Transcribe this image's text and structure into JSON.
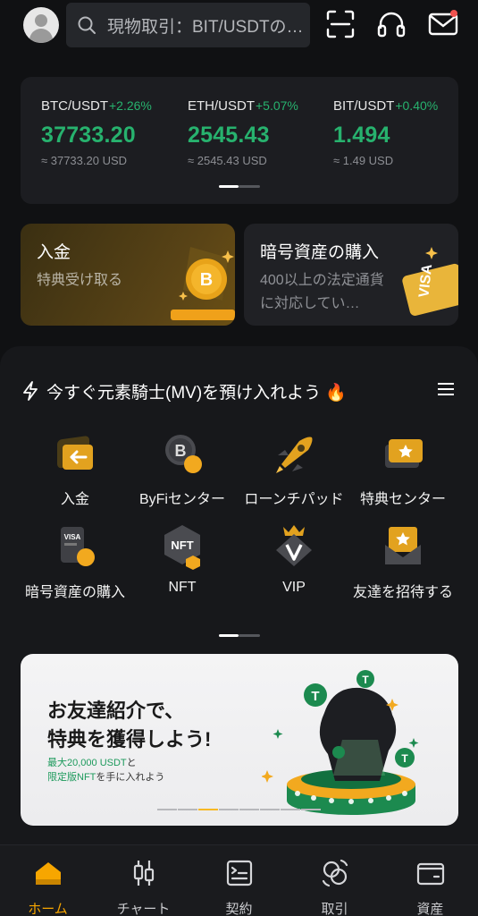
{
  "search": {
    "placeholder": "現物取引：BIT/USDTの…"
  },
  "tickers": [
    {
      "pair": "BTC/USDT",
      "change": "+2.26%",
      "price": "37733.20",
      "usd": "≈ 37733.20 USD"
    },
    {
      "pair": "ETH/USDT",
      "change": "+5.07%",
      "price": "2545.43",
      "usd": "≈ 2545.43 USD"
    },
    {
      "pair": "BIT/USDT",
      "change": "+0.40%",
      "price": "1.494",
      "usd": "≈ 1.49 USD"
    }
  ],
  "promos": {
    "deposit": {
      "title": "入金",
      "subtitle": "特典受け取る"
    },
    "buy": {
      "title": "暗号資産の購入",
      "subtitle": "400以上の法定通貨に対応してい…"
    }
  },
  "announcement": "今すぐ元素騎士(MV)を預け入れよう 🔥",
  "shortcuts": [
    {
      "label": "入金",
      "icon": "deposit-icon"
    },
    {
      "label": "ByFiセンター",
      "icon": "byfi-bitcoin-icon"
    },
    {
      "label": "ローンチパッド",
      "icon": "rocket-icon"
    },
    {
      "label": "特典センター",
      "icon": "reward-ticket-icon"
    },
    {
      "label": "暗号資産の購入",
      "icon": "visa-card-icon"
    },
    {
      "label": "NFT",
      "icon": "nft-icon"
    },
    {
      "label": "VIP",
      "icon": "vip-crown-icon"
    },
    {
      "label": "友達を招待する",
      "icon": "invite-envelope-icon"
    }
  ],
  "referral": {
    "headline1": "お友達紹介で、",
    "headline2": "特典を獲得しよう!",
    "sub1_a": "最大20,000 USDT",
    "sub1_b": "と",
    "sub2_a": "限定版NFT",
    "sub2_b": "を手に入れよう"
  },
  "nav": [
    {
      "label": "ホーム",
      "active": true
    },
    {
      "label": "チャート",
      "active": false
    },
    {
      "label": "契約",
      "active": false
    },
    {
      "label": "取引",
      "active": false
    },
    {
      "label": "資産",
      "active": false
    }
  ],
  "colors": {
    "accent": "#f7a600",
    "up": "#27b26e",
    "background": "#101113",
    "card": "#1c1d21"
  }
}
